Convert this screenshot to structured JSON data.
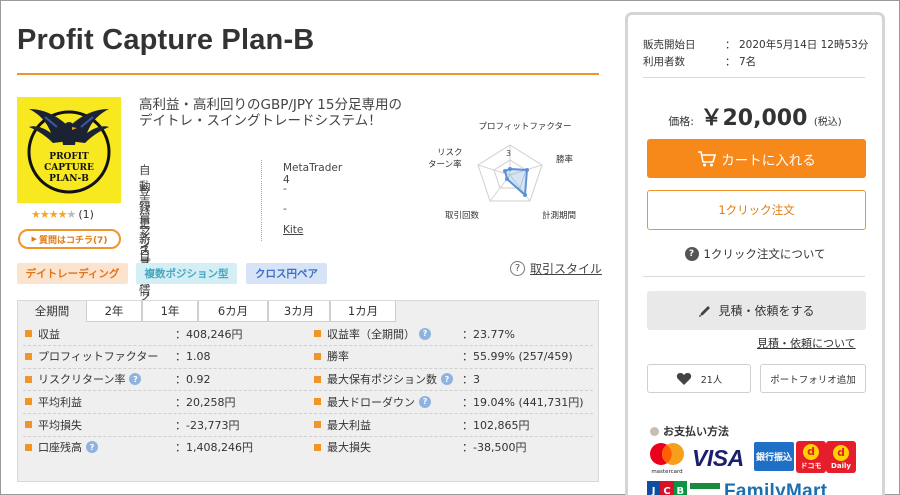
{
  "product": {
    "title": "Profit Capture Plan-B",
    "headline": "高利益・高利回りのGBP/JPY 15分足専用のデイトレ・スイングトレードシステム！",
    "logo_lines": [
      "PROFIT",
      "CAPTURE",
      "PLAN-B"
    ],
    "rating_stars": 4,
    "rating_max": 5,
    "rating_count": "(1)",
    "question_button": "質問はコチラ(7)",
    "info": [
      {
        "key": "自動売買システム",
        "value": "MetaTrader 4"
      },
      {
        "key": "登録更新日",
        "value": "-"
      },
      {
        "key": "バージョン情報",
        "value": "-"
      },
      {
        "key": "マイプロフィール",
        "value": "Kite"
      }
    ]
  },
  "radar": {
    "labels": {
      "top": "プロフィットファクター",
      "right_top": "勝率",
      "right_bottom": "計測期間",
      "left_bottom": "取引回数",
      "left_top_1": "リスク",
      "left_top_2": "ターン率"
    },
    "center_value": "3"
  },
  "tags": [
    "デイトレーディング",
    "複数ポジション型",
    "クロス円ペア"
  ],
  "trade_style_link": "取引スタイル",
  "tabs": [
    "全期間",
    "2年",
    "1年",
    "6カ月",
    "3カ月",
    "1カ月"
  ],
  "stats_left": [
    {
      "label": "収益",
      "value": "：408,246円",
      "help": false
    },
    {
      "label": "プロフィットファクター",
      "value": "：1.08",
      "help": false
    },
    {
      "label": "リスクリターン率",
      "value": "：0.92",
      "help": true
    },
    {
      "label": "平均利益",
      "value": "：20,258円",
      "help": false
    },
    {
      "label": "平均損失",
      "value": "：-23,773円",
      "help": false
    },
    {
      "label": "口座残高",
      "value": "：1,408,246円",
      "help": true
    }
  ],
  "stats_right": [
    {
      "label": "収益率（全期間）",
      "value": "：23.77%",
      "help": true
    },
    {
      "label": "勝率",
      "value": "：55.99% (257/459)",
      "help": false
    },
    {
      "label": "最大保有ポジション数",
      "value": "：3",
      "help": true
    },
    {
      "label": "最大ドローダウン",
      "value": "：19.04% (441,731円)",
      "help": true
    },
    {
      "label": "最大利益",
      "value": "：102,865円",
      "help": false
    },
    {
      "label": "最大損失",
      "value": "：-38,500円",
      "help": false
    }
  ],
  "sidebar": {
    "sale_start_label": "販売開始日",
    "sale_start_value": "2020年5月14日 12時53分",
    "users_label": "利用者数",
    "users_value": "7名",
    "colon": "：",
    "price_label": "価格:",
    "price_value": "￥20,000",
    "price_tax": "(税込)",
    "cart_button": "カートに入れる",
    "oneclick_button": "1クリック注文",
    "about_oneclick": "1クリック注文について",
    "quote_button": "見積・依頼をする",
    "quote_link": "見積・依頼について",
    "favorite_count": "21人",
    "portfolio_button": "ポートフォリオ追加",
    "payment_title": "お支払い方法",
    "payment": {
      "mastercard": "mastercard",
      "visa": "VISA",
      "bank": "銀行振込",
      "dpay_1": "ドコモ",
      "dpay_2": "Daily",
      "jcb": [
        "J",
        "C",
        "B"
      ],
      "familymart": "FamilyMart"
    }
  },
  "colors": {
    "accent": "#f0952b",
    "cart": "#f7881a",
    "logo_bg": "#f7e81f"
  }
}
